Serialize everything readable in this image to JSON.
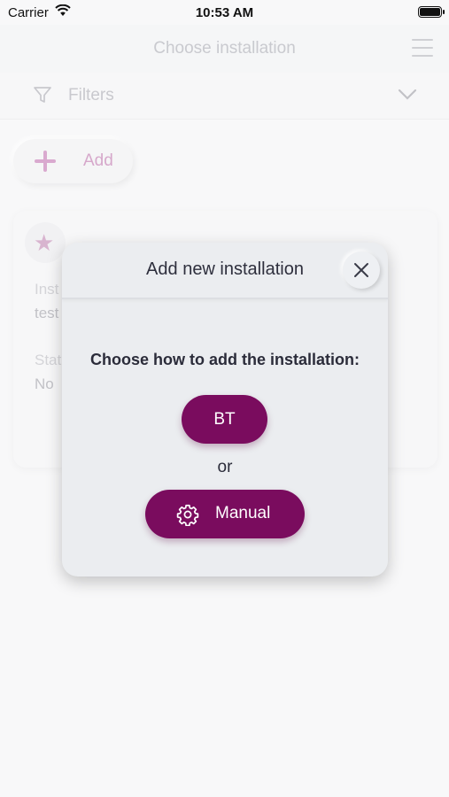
{
  "status_bar": {
    "carrier": "Carrier",
    "time": "10:53 AM"
  },
  "header": {
    "title": "Choose installation",
    "menu_icon": "hamburger-icon"
  },
  "filters": {
    "label": "Filters",
    "icon": "funnel-icon",
    "toggle_icon": "chevron-down-icon"
  },
  "add_button": {
    "label": "Add",
    "icon": "plus-icon"
  },
  "installation_card": {
    "favorite_icon": "star-icon",
    "field1_label": "Inst",
    "field1_value": "test",
    "field2_label": "Stat",
    "field2_value": "No"
  },
  "dialog": {
    "title": "Add new installation",
    "close_icon": "close-icon",
    "prompt": "Choose how to add the installation:",
    "bt_label": "BT",
    "or_text": "or",
    "manual_label": "Manual",
    "manual_icon": "gear-icon"
  },
  "colors": {
    "brand": "#7a0c5e",
    "accent_light": "#d9a9cf",
    "background": "#f8f8f9",
    "dialog_bg": "#ebedf0"
  }
}
